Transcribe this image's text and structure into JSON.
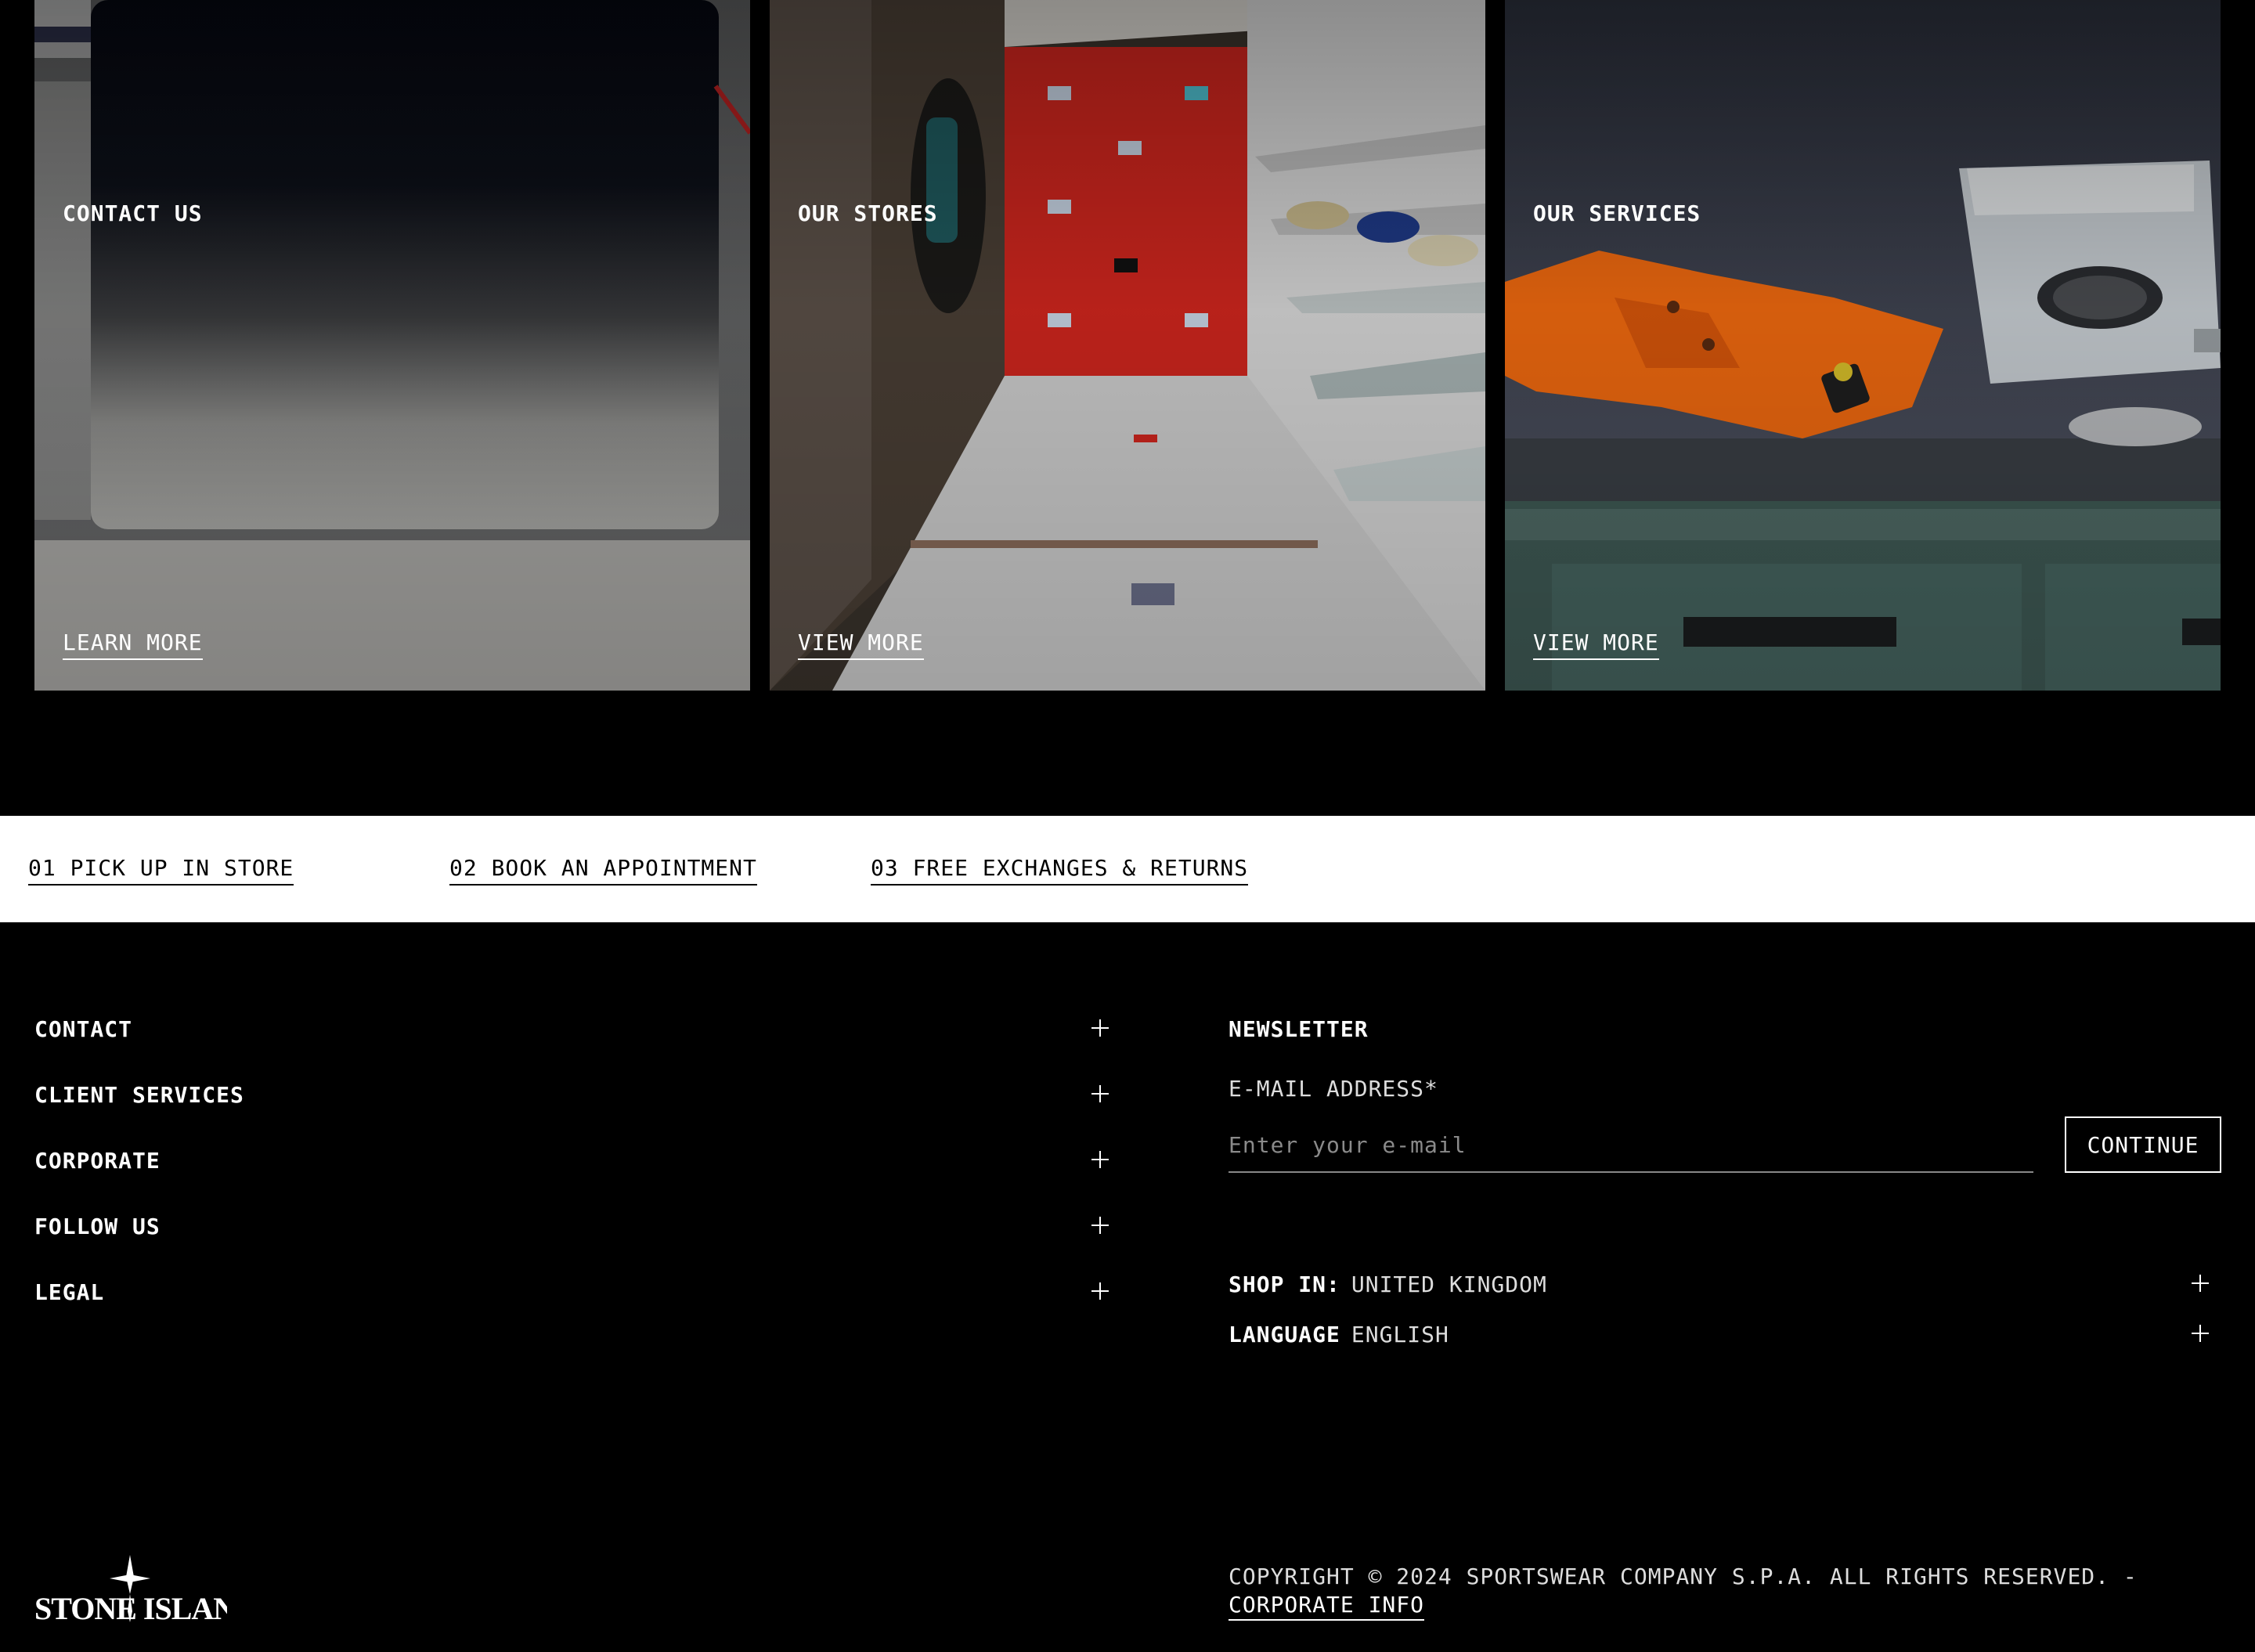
{
  "cards": [
    {
      "title": "CONTACT US",
      "link": "LEARN MORE"
    },
    {
      "title": "OUR STORES",
      "link": "VIEW MORE"
    },
    {
      "title": "OUR SERVICES",
      "link": "VIEW MORE"
    }
  ],
  "services": [
    "01 PICK UP IN STORE",
    "02 BOOK AN APPOINTMENT",
    "03 FREE EXCHANGES & RETURNS"
  ],
  "footer": {
    "accordion": [
      "CONTACT",
      "CLIENT SERVICES",
      "CORPORATE",
      "FOLLOW US",
      "LEGAL"
    ],
    "newsletter": {
      "title": "NEWSLETTER",
      "email_label": "E-MAIL ADDRESS*",
      "email_placeholder": "Enter your e-mail",
      "button": "CONTINUE"
    },
    "shop_in": {
      "label": "SHOP IN:",
      "value": "UNITED KINGDOM"
    },
    "language": {
      "label": "LANGUAGE",
      "value": "ENGLISH"
    },
    "logo_text": "STONE ISLAND",
    "copyright": "COPYRIGHT © 2024 SPORTSWEAR COMPANY S.P.A. ALL RIGHTS RESERVED. -",
    "corporate_info": "CORPORATE INFO"
  },
  "colors": {
    "background": "#000000",
    "strip": "#ffffff",
    "store_red": "#d1261e",
    "jacket_orange": "#f26a0f",
    "counter_teal": "#3f5a55"
  }
}
